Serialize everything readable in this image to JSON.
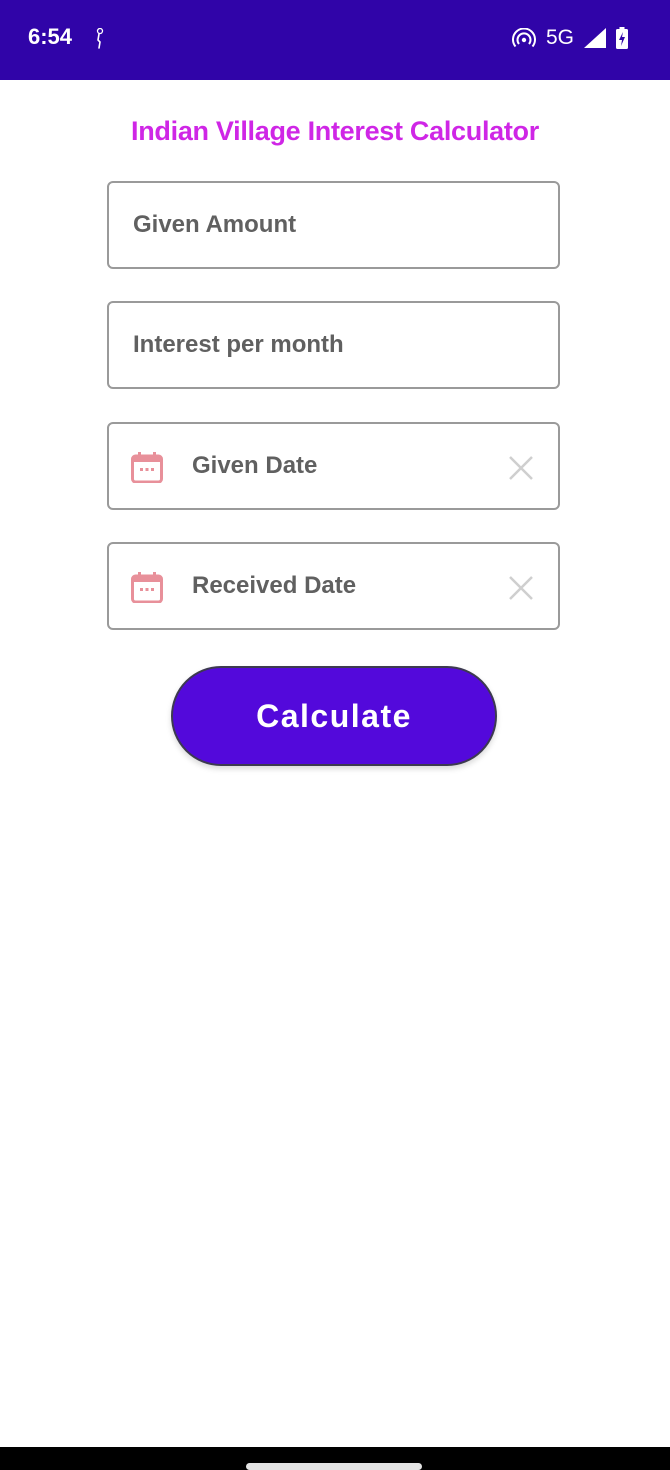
{
  "status_bar": {
    "time": "6:54",
    "notification_icon": "fitness-figure-icon",
    "icons": [
      "hotspot-icon",
      "signal-icon",
      "battery-charging-icon"
    ],
    "network": "5G",
    "background_color": "#3004a8"
  },
  "app": {
    "title": "Indian Village Interest Calculator",
    "title_color": "#cf26e6"
  },
  "form": {
    "given_amount": {
      "placeholder": "Given Amount",
      "value": ""
    },
    "interest_per_month": {
      "placeholder": "Interest per month",
      "value": ""
    },
    "given_date": {
      "placeholder": "Given Date",
      "value": "",
      "icon": "calendar-icon",
      "clear_icon": "close-icon"
    },
    "received_date": {
      "placeholder": "Received Date",
      "value": "",
      "icon": "calendar-icon",
      "clear_icon": "close-icon"
    }
  },
  "calculate_button": {
    "label": "Calculate",
    "color": "#5309db"
  },
  "colors": {
    "field_border": "#9a9a9a",
    "placeholder_text": "#606060",
    "calendar_icon": "#e8909a",
    "clear_icon": "#cfcfcf"
  }
}
